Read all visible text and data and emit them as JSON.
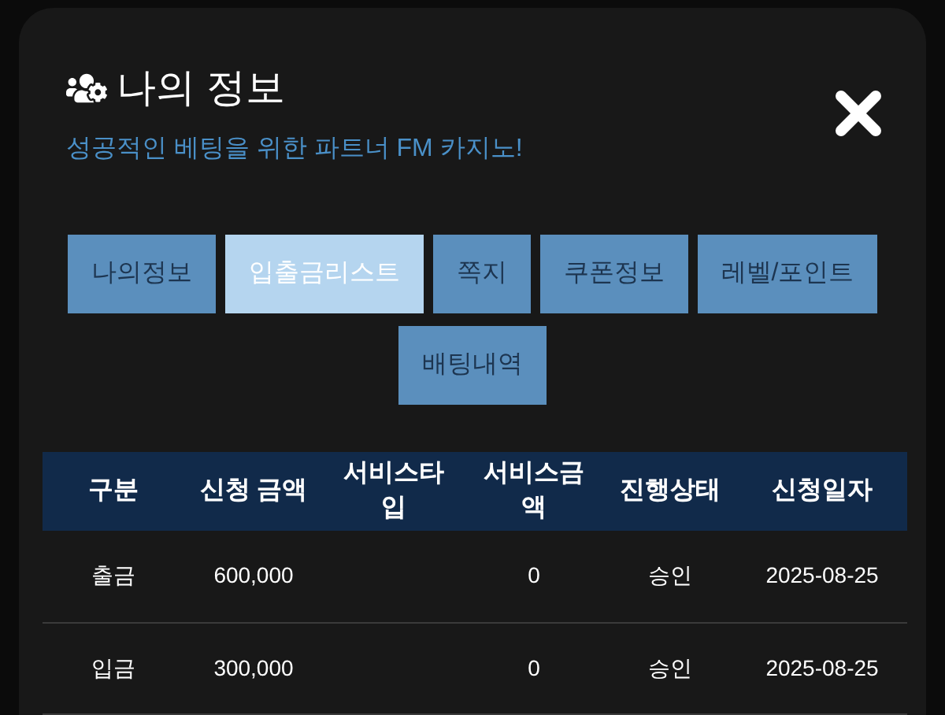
{
  "modal": {
    "title": "나의 정보",
    "subtitle": "성공적인 베팅을 위한 파트너 FM 카지노!"
  },
  "tabs": [
    {
      "label": "나의정보",
      "selected": false
    },
    {
      "label": "입출금리스트",
      "selected": true
    },
    {
      "label": "쪽지",
      "selected": false
    },
    {
      "label": "쿠폰정보",
      "selected": false
    },
    {
      "label": "레벨/포인트",
      "selected": false
    },
    {
      "label": "배팅내역",
      "selected": false
    }
  ],
  "table": {
    "columns": [
      "구분",
      "신청 금액",
      "서비스타입",
      "서비스금액",
      "진행상태",
      "신청일자"
    ],
    "rows": [
      [
        "출금",
        "600,000",
        "",
        "0",
        "승인",
        "2025-08-25"
      ],
      [
        "입금",
        "300,000",
        "",
        "0",
        "승인",
        "2025-08-25"
      ]
    ]
  }
}
